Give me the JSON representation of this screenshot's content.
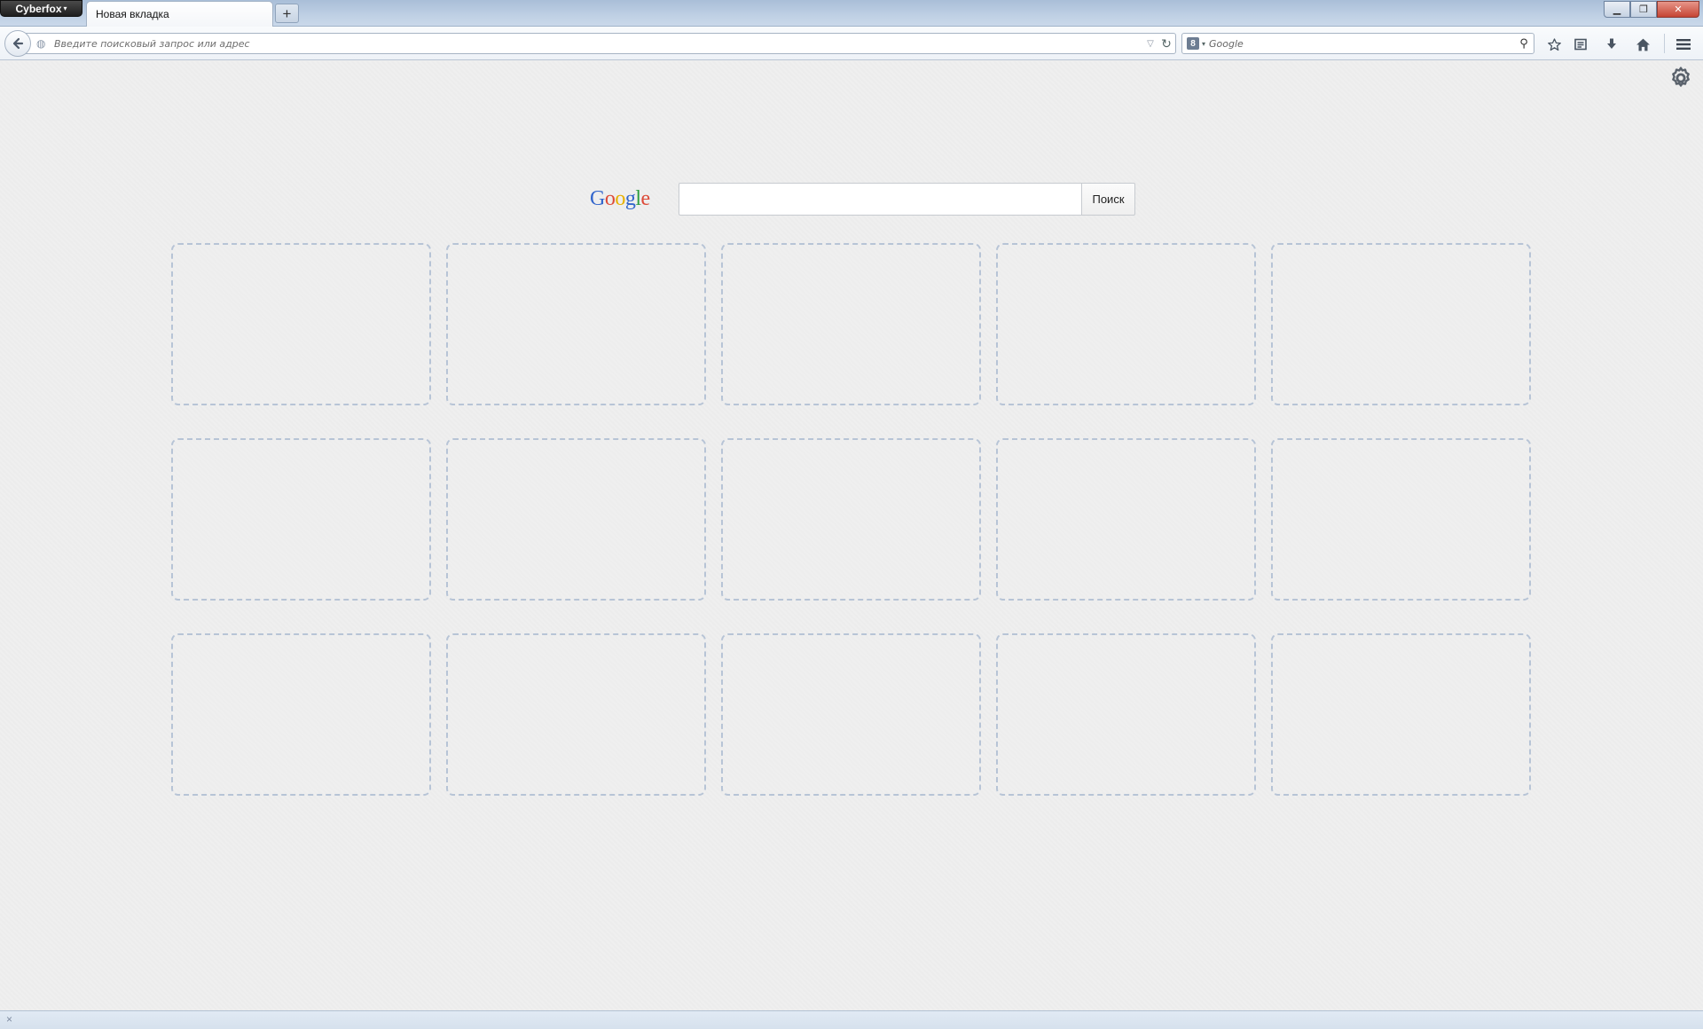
{
  "window": {
    "app_menu_label": "Cyberfox",
    "app_menu_caret": "▾",
    "controls": {
      "minimize": "▁",
      "restore": "❐",
      "close": "✕"
    }
  },
  "tabs": [
    {
      "label": "Новая вкладка",
      "active": true
    }
  ],
  "new_tab_label": "+",
  "navbar": {
    "back_icon": "arrow-left-icon",
    "url_placeholder": "Введите поисковый запрос или адрес",
    "search_placeholder": "Google",
    "search_engine_icon": "8",
    "icons": [
      "star-icon",
      "reading-list-icon",
      "download-icon",
      "home-icon",
      "menu-icon"
    ]
  },
  "content": {
    "google_logo": [
      {
        "char": "G",
        "color": "#3366cc"
      },
      {
        "char": "o",
        "color": "#dd4b39"
      },
      {
        "char": "o",
        "color": "#e8b100"
      },
      {
        "char": "g",
        "color": "#3366cc"
      },
      {
        "char": "l",
        "color": "#2e9e3f"
      },
      {
        "char": "e",
        "color": "#dd4b39"
      }
    ],
    "search_button": "Поиск",
    "search_value": "",
    "tile_count": 15
  },
  "status": {
    "close_glyph": "×"
  }
}
